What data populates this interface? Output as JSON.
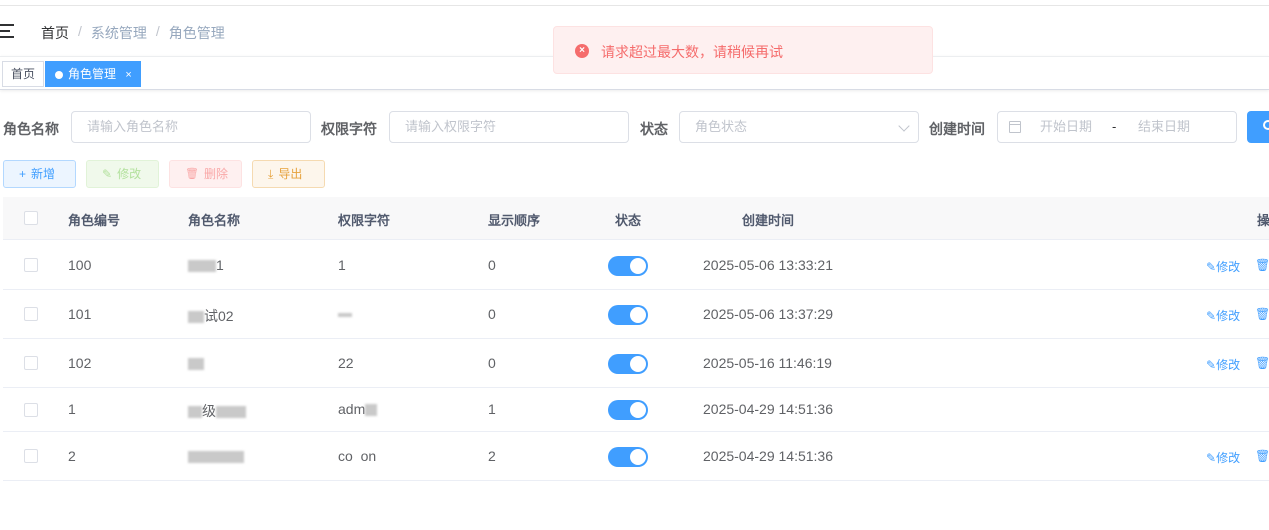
{
  "breadcrumb": {
    "home": "首页",
    "sep": "/",
    "level1": "系统管理",
    "level2": "角色管理"
  },
  "tags": [
    {
      "label": "首页",
      "close": ""
    },
    {
      "label": "角色管理",
      "close": "×"
    }
  ],
  "toast": {
    "message": "请求超过最大数，请稍候再试",
    "icon": "×"
  },
  "search": {
    "role_name_label": "角色名称",
    "role_name_placeholder": "请输入角色名称",
    "role_key_label": "权限字符",
    "role_key_placeholder": "请输入权限字符",
    "status_label": "状态",
    "status_placeholder": "角色状态",
    "created_label": "创建时间",
    "start_placeholder": "开始日期",
    "range_sep": "-",
    "end_placeholder": "结束日期"
  },
  "toolbar": {
    "add": {
      "icon": "+",
      "label": "新增"
    },
    "edit": {
      "icon": "✎",
      "label": "修改"
    },
    "delete": {
      "icon": "🗑",
      "label": "删除"
    },
    "export": {
      "icon": "⤓",
      "label": "导出"
    }
  },
  "table": {
    "headers": {
      "id": "角色编号",
      "name": "角色名称",
      "key": "权限字符",
      "sort": "显示顺序",
      "status": "状态",
      "created": "创建时间",
      "ops": "操"
    },
    "rows": [
      {
        "id": "100",
        "name": "1",
        "key": "1",
        "sort": "0",
        "created": "2025-05-06 13:33:21",
        "edit": "修改",
        "status_on": true
      },
      {
        "id": "101",
        "name": "试02",
        "key": "",
        "sort": "0",
        "created": "2025-05-06 13:37:29",
        "edit": "修改",
        "status_on": true
      },
      {
        "id": "102",
        "name": "",
        "key": "22",
        "sort": "0",
        "created": "2025-05-16 11:46:19",
        "edit": "修改",
        "status_on": true
      },
      {
        "id": "1",
        "name": "级",
        "key": "adm",
        "sort": "1",
        "created": "2025-04-29 14:51:36",
        "edit": "",
        "status_on": true
      },
      {
        "id": "2",
        "name": "",
        "key": "co  on",
        "sort": "2",
        "created": "2025-04-29 14:51:36",
        "edit": "修改",
        "status_on": true
      }
    ]
  },
  "colors": {
    "primary": "#409eff",
    "danger": "#f56c6c",
    "success": "#67c23a",
    "warning": "#e6a23c"
  }
}
